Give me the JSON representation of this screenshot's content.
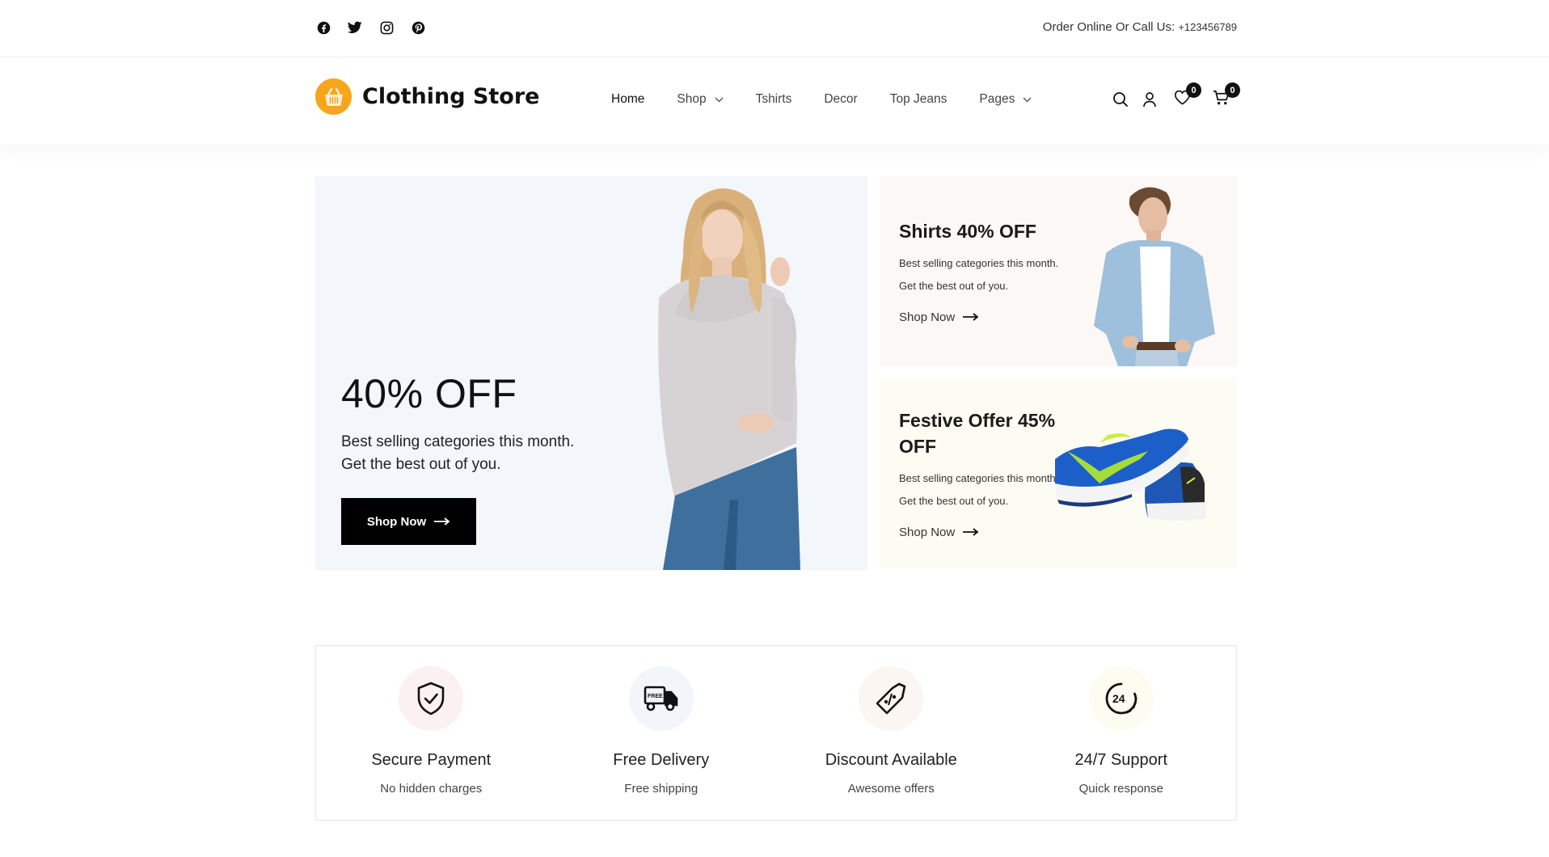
{
  "topbar": {
    "socials": [
      {
        "icon": "facebook-icon",
        "label": "Facebook"
      },
      {
        "icon": "twitter-icon",
        "label": "Twitter"
      },
      {
        "icon": "instagram-icon",
        "label": "Instagram"
      },
      {
        "icon": "pinterest-icon",
        "label": "Pinterest"
      }
    ],
    "contact_label": "Order Online Or Call Us:",
    "contact_phone": "+123456789"
  },
  "header": {
    "logo_icon": "shopping-basket-icon",
    "brand": "Clothing Store",
    "brand_color": "#f8a51b",
    "menu": [
      {
        "label": "Home",
        "has_dropdown": false,
        "active": true
      },
      {
        "label": "Shop",
        "has_dropdown": true,
        "active": false
      },
      {
        "label": "Tshirts",
        "has_dropdown": false,
        "active": false
      },
      {
        "label": "Decor",
        "has_dropdown": false,
        "active": false
      },
      {
        "label": "Top Jeans",
        "has_dropdown": false,
        "active": false
      },
      {
        "label": "Pages",
        "has_dropdown": true,
        "active": false
      }
    ],
    "actions": {
      "search_icon": "search-icon",
      "account_icon": "user-icon",
      "wishlist_icon": "heart-icon",
      "wishlist_count": "0",
      "cart_icon": "cart-icon",
      "cart_count": "0"
    }
  },
  "hero": {
    "title": "40% OFF",
    "description": "Best selling categories this month. Get the best out of you.",
    "button_label": "Shop Now",
    "button_icon": "arrow-right-icon",
    "image_alt": "Woman in grey cowl-neck sweater",
    "background": "#f3f6fa"
  },
  "promos": [
    {
      "title": "Shirts 40% OFF",
      "description": "Best selling categories this month. Get the best out of you.",
      "link_label": "Shop Now",
      "image_alt": "Man in denim jacket",
      "background": "#fcf8f5"
    },
    {
      "title": "Festive Offer 45% OFF",
      "description": "Best selling categories this month. Get the best out of you.",
      "link_label": "Shop Now",
      "image_alt": "Blue running shoes",
      "background": "#fdfcf2"
    }
  ],
  "features": [
    {
      "icon": "shield-check-icon",
      "title": "Secure Payment",
      "subtitle": "No hidden charges",
      "circle_color": "#fcf1f1"
    },
    {
      "icon": "free-delivery-truck-icon",
      "title": "Free Delivery",
      "subtitle": "Free shipping",
      "circle_color": "#f2f6fb"
    },
    {
      "icon": "discount-tag-icon",
      "title": "Discount Available",
      "subtitle": "Awesome offers",
      "circle_color": "#fcf6f2"
    },
    {
      "icon": "support-24-icon",
      "title": "24/7 Support",
      "subtitle": "Quick response",
      "circle_color": "#fdfcf1"
    }
  ]
}
